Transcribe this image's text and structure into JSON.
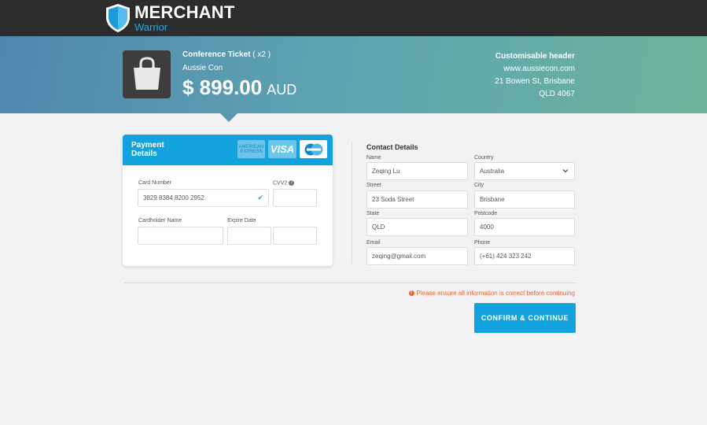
{
  "brand": {
    "name": "MERCHANT",
    "sub": "Warrior",
    "colors": {
      "topbar": "#2c2c2c",
      "accent": "#12a3de",
      "warning": "#e8643c"
    }
  },
  "product": {
    "icon": "shopping-bag-icon",
    "title": "Conference Ticket",
    "quantity": "( x2 )",
    "subtitle": "Aussie Con",
    "price": "$ 899.00",
    "currency": "AUD"
  },
  "merchant": {
    "header": "Customisable header",
    "website": "www.aussiecon.com",
    "address_line1": "21 Bowen St, Brisbane",
    "address_line2": "QLD 4067"
  },
  "payment": {
    "title": "Payment Details",
    "card_logos": {
      "amex_line1": "AMERICAN",
      "amex_line2": "EXPRESS",
      "visa": "VISA",
      "mastercard": "MasterCard"
    },
    "card_number_label": "Card Number",
    "card_number_value": "3829 8384 8200 2952",
    "cvv_label": "CVV2",
    "cvv_value": "",
    "cardholder_label": "Cardholder Name",
    "cardholder_value": "",
    "expiry_label": "Expire Date",
    "expiry_month": "",
    "expiry_year": ""
  },
  "contact": {
    "title": "Contact Details",
    "name_label": "Name",
    "name_value": "Zeqing Lu",
    "country_label": "Country",
    "country_value": "Australia",
    "street_label": "Street",
    "street_value": "23 Soda Street",
    "city_label": "City",
    "city_value": "Brisbane",
    "state_label": "State",
    "state_value": "QLD",
    "postcode_label": "Postcode",
    "postcode_value": "4000",
    "email_label": "Email",
    "email_value": "zeqing@gmail.com",
    "phone_label": "Phone",
    "phone_value": "(+61) 424 323 242"
  },
  "footer": {
    "warning": "Please ensure all information is correct before continuing",
    "confirm_label": "CONFIRM & CONTINUE"
  }
}
